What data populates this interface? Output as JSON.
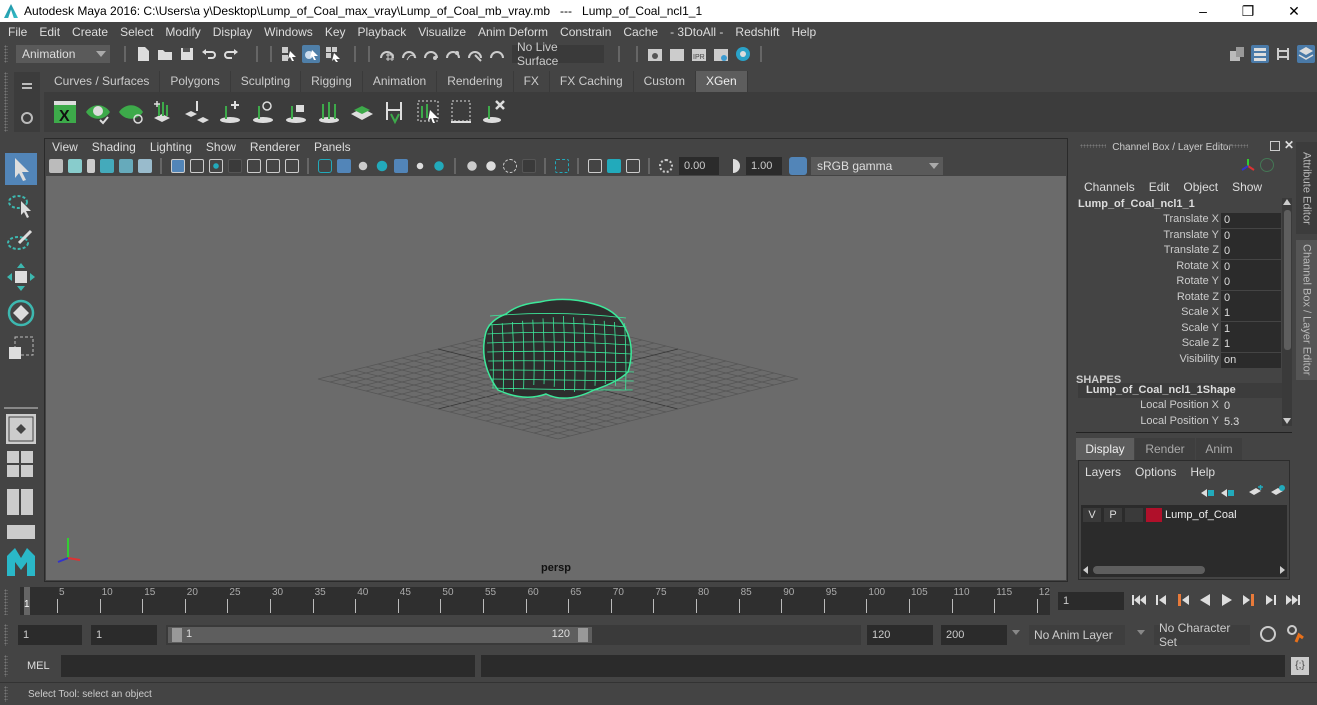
{
  "window": {
    "title": "Autodesk Maya 2016: C:\\Users\\a y\\Desktop\\Lump_of_Coal_max_vray\\Lump_of_Coal_mb_vray.mb   ---   Lump_of_Coal_ncl1_1",
    "controls": {
      "minimize": "–",
      "maximize": "❐",
      "close": "✕"
    }
  },
  "menubar": [
    "File",
    "Edit",
    "Create",
    "Select",
    "Modify",
    "Display",
    "Windows",
    "Key",
    "Playback",
    "Visualize",
    "Anim Deform",
    "Constrain",
    "Cache",
    "- 3DtoAll -",
    "Redshift",
    "Help"
  ],
  "statusline": {
    "menuset": "Animation",
    "live_surface": "No Live Surface"
  },
  "shelf": {
    "tabs": [
      "Curves / Surfaces",
      "Polygons",
      "Sculpting",
      "Rigging",
      "Animation",
      "Rendering",
      "FX",
      "FX Caching",
      "Custom",
      "XGen"
    ],
    "active_tab": "XGen",
    "icons": [
      "xgen-window-icon",
      "preview-icon",
      "hide-preview-icon",
      "create-description-icon",
      "place-guides-icon",
      "add-guide-icon",
      "sculpt-guide-icon",
      "lock-guide-icon",
      "guides-to-curves-icon",
      "create-patch-icon",
      "bind-guides-icon",
      "select-guides-icon",
      "rebuild-guides-icon",
      "delete-guides-icon"
    ]
  },
  "viewport": {
    "menu": [
      "View",
      "Shading",
      "Lighting",
      "Show",
      "Renderer",
      "Panels"
    ],
    "exposure": "0.00",
    "gamma": "1.00",
    "color_space": "sRGB gamma",
    "camera_label": "persp",
    "object_color": "#3de89a"
  },
  "channel_box": {
    "title": "Channel Box / Layer Editor",
    "menu": [
      "Channels",
      "Edit",
      "Object",
      "Show"
    ],
    "object_name": "Lump_of_Coal_ncl1_1",
    "channels": [
      {
        "label": "Translate X",
        "value": "0"
      },
      {
        "label": "Translate Y",
        "value": "0"
      },
      {
        "label": "Translate Z",
        "value": "0"
      },
      {
        "label": "Rotate X",
        "value": "0"
      },
      {
        "label": "Rotate Y",
        "value": "0"
      },
      {
        "label": "Rotate Z",
        "value": "0"
      },
      {
        "label": "Scale X",
        "value": "1"
      },
      {
        "label": "Scale Y",
        "value": "1"
      },
      {
        "label": "Scale Z",
        "value": "1"
      },
      {
        "label": "Visibility",
        "value": "on"
      }
    ],
    "shapes_header": "SHAPES",
    "shape_name": "Lump_of_Coal_ncl1_1Shape",
    "shape_channels": [
      {
        "label": "Local Position X",
        "value": "0"
      },
      {
        "label": "Local Position Y",
        "value": "5.3"
      }
    ]
  },
  "layer_editor": {
    "tabs": [
      "Display",
      "Render",
      "Anim"
    ],
    "active_tab": "Display",
    "menu": [
      "Layers",
      "Options",
      "Help"
    ],
    "layers": [
      {
        "v": "V",
        "p": "P",
        "name": "Lump_of_Coal",
        "color": "#b0102a"
      }
    ]
  },
  "side_tabs": [
    "Attribute Editor",
    "Channel Box / Layer Editor"
  ],
  "timeline": {
    "ticks": [
      "5",
      "10",
      "15",
      "20",
      "25",
      "30",
      "35",
      "40",
      "45",
      "50",
      "55",
      "60",
      "65",
      "70",
      "75",
      "80",
      "85",
      "90",
      "95",
      "100",
      "105",
      "110",
      "115",
      "12"
    ],
    "current_frame_marker": "1",
    "current_frame": "1"
  },
  "range": {
    "start": "1",
    "playback_start": "1",
    "slider_start": "1",
    "slider_end": "120",
    "playback_end": "120",
    "end": "200",
    "anim_layer": "No Anim Layer",
    "character_set": "No Character Set"
  },
  "command_line": {
    "label": "MEL",
    "value": "",
    "result": ""
  },
  "help_line": "Select Tool: select an object"
}
